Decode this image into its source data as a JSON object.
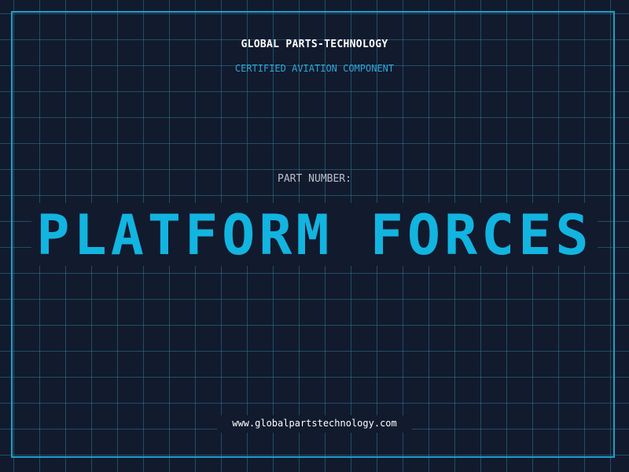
{
  "header": {
    "company": "GLOBAL PARTS-TECHNOLOGY",
    "tagline": "CERTIFIED AVIATION COMPONENT"
  },
  "part": {
    "label": "PART NUMBER:",
    "name": "PLATFORM FORCES"
  },
  "footer": {
    "url": "www.globalpartstechnology.com"
  },
  "colors": {
    "background": "#121a2e",
    "grid": "#2d788c",
    "frame": "#1f9fc8",
    "accent": "#12b4e0",
    "tagline": "#2ea6d6"
  }
}
